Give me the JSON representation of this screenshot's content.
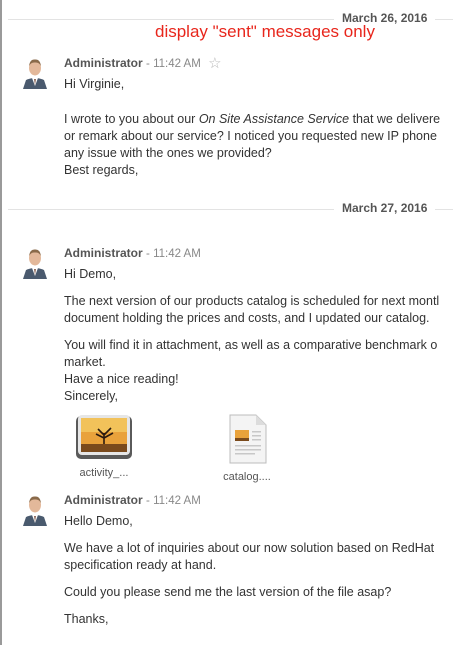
{
  "annotation": "display \"sent\" messages only",
  "dates": [
    "March 26, 2016",
    "March 27, 2016"
  ],
  "messages": [
    {
      "author": "Administrator",
      "time": "11:42 AM",
      "greeting": "Hi Virginie,",
      "paragraphs": [
        [
          "I wrote to you about our ",
          "On Site Assistance Service",
          " that we delivere",
          "or remark about our service? I noticed you requested new IP phone",
          "any issue with the ones we provided?",
          "Best regards,"
        ]
      ]
    },
    {
      "author": "Administrator",
      "time": "11:42 AM",
      "greeting": "Hi Demo,",
      "paragraphs": [
        [
          "The next version of our products catalog is scheduled for next montl",
          "document holding the prices and costs, and I updated our catalog."
        ],
        [
          "You will find it in attachment, as well as a comparative benchmark o",
          "market.",
          "Have a nice reading!",
          "Sincerely,"
        ]
      ],
      "attachments": [
        "activity_...",
        "catalog...."
      ]
    },
    {
      "author": "Administrator",
      "time": "11:42 AM",
      "greeting": "Hello Demo,",
      "paragraphs": [
        [
          "We have a lot of inquiries about our now solution based on RedHat",
          "specification ready at hand."
        ],
        [
          "Could you please send me the last version of the file asap?"
        ],
        [
          "Thanks,"
        ]
      ]
    }
  ]
}
